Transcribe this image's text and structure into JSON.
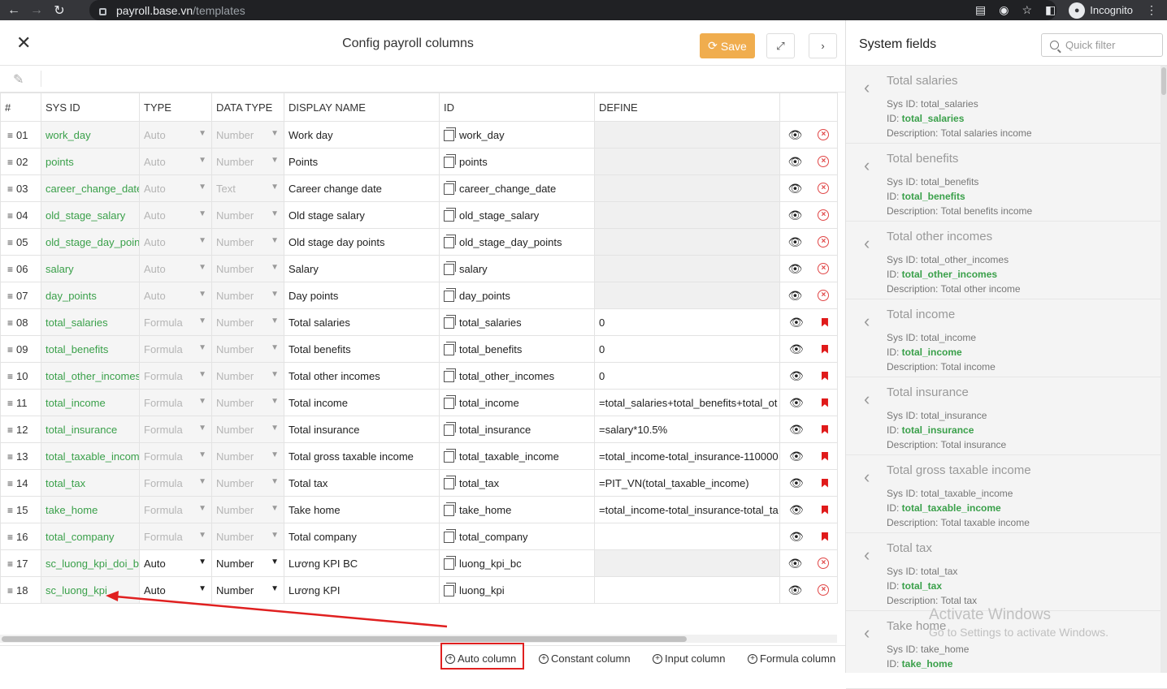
{
  "browser": {
    "url_host": "payroll.base.vn",
    "url_path": "/templates",
    "profile_label": "Incognito"
  },
  "header": {
    "title": "Config payroll columns",
    "save_label": "Save"
  },
  "columns": [
    "#",
    "SYS ID",
    "TYPE",
    "DATA TYPE",
    "DISPLAY NAME",
    "ID",
    "DEFINE"
  ],
  "rows": [
    {
      "num": "01",
      "sys_id": "work_day",
      "type": "Auto",
      "data_type": "Number",
      "display": "Work day",
      "id": "work_day",
      "define": "",
      "editable": false,
      "deletable": true
    },
    {
      "num": "02",
      "sys_id": "points",
      "type": "Auto",
      "data_type": "Number",
      "display": "Points",
      "id": "points",
      "define": "",
      "editable": false,
      "deletable": true
    },
    {
      "num": "03",
      "sys_id": "career_change_date_",
      "type": "Auto",
      "data_type": "Text",
      "display": "Career change date",
      "id": "career_change_date",
      "define": "",
      "editable": false,
      "deletable": true
    },
    {
      "num": "04",
      "sys_id": "old_stage_salary",
      "type": "Auto",
      "data_type": "Number",
      "display": "Old stage salary",
      "id": "old_stage_salary",
      "define": "",
      "editable": false,
      "deletable": true
    },
    {
      "num": "05",
      "sys_id": "old_stage_day_points",
      "type": "Auto",
      "data_type": "Number",
      "display": "Old stage day points",
      "id": "old_stage_day_points",
      "define": "",
      "editable": false,
      "deletable": true
    },
    {
      "num": "06",
      "sys_id": "salary",
      "type": "Auto",
      "data_type": "Number",
      "display": "Salary",
      "id": "salary",
      "define": "",
      "editable": false,
      "deletable": true
    },
    {
      "num": "07",
      "sys_id": "day_points",
      "type": "Auto",
      "data_type": "Number",
      "display": "Day points",
      "id": "day_points",
      "define": "",
      "editable": false,
      "deletable": true
    },
    {
      "num": "08",
      "sys_id": "total_salaries",
      "type": "Formula",
      "data_type": "Number",
      "display": "Total salaries",
      "id": "total_salaries",
      "define": "0",
      "editable": false,
      "deletable": false
    },
    {
      "num": "09",
      "sys_id": "total_benefits",
      "type": "Formula",
      "data_type": "Number",
      "display": "Total benefits",
      "id": "total_benefits",
      "define": "0",
      "editable": false,
      "deletable": false
    },
    {
      "num": "10",
      "sys_id": "total_other_incomes",
      "type": "Formula",
      "data_type": "Number",
      "display": "Total other incomes",
      "id": "total_other_incomes",
      "define": "0",
      "editable": false,
      "deletable": false
    },
    {
      "num": "11",
      "sys_id": "total_income",
      "type": "Formula",
      "data_type": "Number",
      "display": "Total income",
      "id": "total_income",
      "define": "=total_salaries+total_benefits+total_ot",
      "editable": false,
      "deletable": false
    },
    {
      "num": "12",
      "sys_id": "total_insurance",
      "type": "Formula",
      "data_type": "Number",
      "display": "Total insurance",
      "id": "total_insurance",
      "define": "=salary*10.5%",
      "editable": false,
      "deletable": false
    },
    {
      "num": "13",
      "sys_id": "total_taxable_income",
      "type": "Formula",
      "data_type": "Number",
      "display": "Total gross taxable income",
      "id": "total_taxable_income",
      "define": "=total_income-total_insurance-110000",
      "editable": false,
      "deletable": false
    },
    {
      "num": "14",
      "sys_id": "total_tax",
      "type": "Formula",
      "data_type": "Number",
      "display": "Total tax",
      "id": "total_tax",
      "define": "=PIT_VN(total_taxable_income)",
      "editable": false,
      "deletable": false
    },
    {
      "num": "15",
      "sys_id": "take_home",
      "type": "Formula",
      "data_type": "Number",
      "display": "Take home",
      "id": "take_home",
      "define": "=total_income-total_insurance-total_ta",
      "editable": false,
      "deletable": false
    },
    {
      "num": "16",
      "sys_id": "total_company",
      "type": "Formula",
      "data_type": "Number",
      "display": "Total company",
      "id": "total_company",
      "define": "",
      "editable": false,
      "deletable": false,
      "define_white": true
    },
    {
      "num": "17",
      "sys_id": "sc_luong_kpi_doi_bc",
      "type": "Auto",
      "data_type": "Number",
      "display": "Lương KPI BC",
      "id": "luong_kpi_bc",
      "define": "",
      "editable": true,
      "deletable": true
    },
    {
      "num": "18",
      "sys_id": "sc_luong_kpi",
      "type": "Auto",
      "data_type": "Number",
      "display": "Lương KPI",
      "id": "luong_kpi",
      "define": "",
      "editable": true,
      "deletable": true,
      "define_white": true
    }
  ],
  "bottom_actions": [
    "Auto column",
    "Constant column",
    "Input column",
    "Formula column"
  ],
  "system_fields": {
    "title": "System fields",
    "filter_placeholder": "Quick filter",
    "sys_id_prefix": "Sys ID: ",
    "id_prefix": "ID: ",
    "desc_prefix": "Description: ",
    "items": [
      {
        "name": "Total salaries",
        "sys_id": "total_salaries",
        "id": "total_salaries",
        "desc": "Total salaries income"
      },
      {
        "name": "Total benefits",
        "sys_id": "total_benefits",
        "id": "total_benefits",
        "desc": "Total benefits income"
      },
      {
        "name": "Total other incomes",
        "sys_id": "total_other_incomes",
        "id": "total_other_incomes",
        "desc": "Total other income"
      },
      {
        "name": "Total income",
        "sys_id": "total_income",
        "id": "total_income",
        "desc": "Total income"
      },
      {
        "name": "Total insurance",
        "sys_id": "total_insurance",
        "id": "total_insurance",
        "desc": "Total insurance"
      },
      {
        "name": "Total gross taxable income",
        "sys_id": "total_taxable_income",
        "id": "total_taxable_income",
        "desc": "Total taxable income"
      },
      {
        "name": "Total tax",
        "sys_id": "total_tax",
        "id": "total_tax",
        "desc": "Total tax"
      },
      {
        "name": "Take home",
        "sys_id": "take_home",
        "id": "take_home",
        "desc": ""
      }
    ]
  },
  "watermark": {
    "line1": "Activate Windows",
    "line2": "Go to Settings to activate Windows."
  },
  "colors": {
    "accent_save": "#f0ad4e",
    "sys_id_green": "#3aa04a",
    "delete_red": "#e04545",
    "annotation_red": "#e02020"
  }
}
